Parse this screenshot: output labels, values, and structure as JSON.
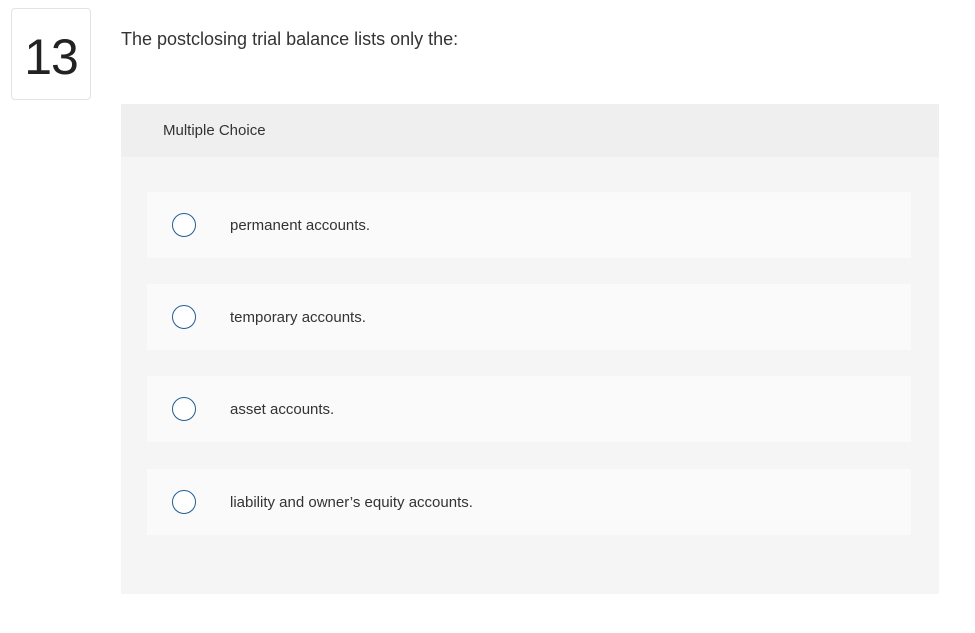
{
  "question": {
    "number": "13",
    "text": "The postclosing trial balance lists only the:"
  },
  "multiple_choice": {
    "header": "Multiple Choice",
    "options": [
      {
        "label": "permanent accounts.",
        "selected": false
      },
      {
        "label": "temporary accounts.",
        "selected": false
      },
      {
        "label": "asset accounts.",
        "selected": false
      },
      {
        "label": "liability and owner’s equity accounts.",
        "selected": false
      }
    ]
  },
  "colors": {
    "radio_border": "#1f5e96",
    "panel_bg": "#f5f5f5",
    "header_bg": "#efefef",
    "option_bg": "#fafafa"
  }
}
